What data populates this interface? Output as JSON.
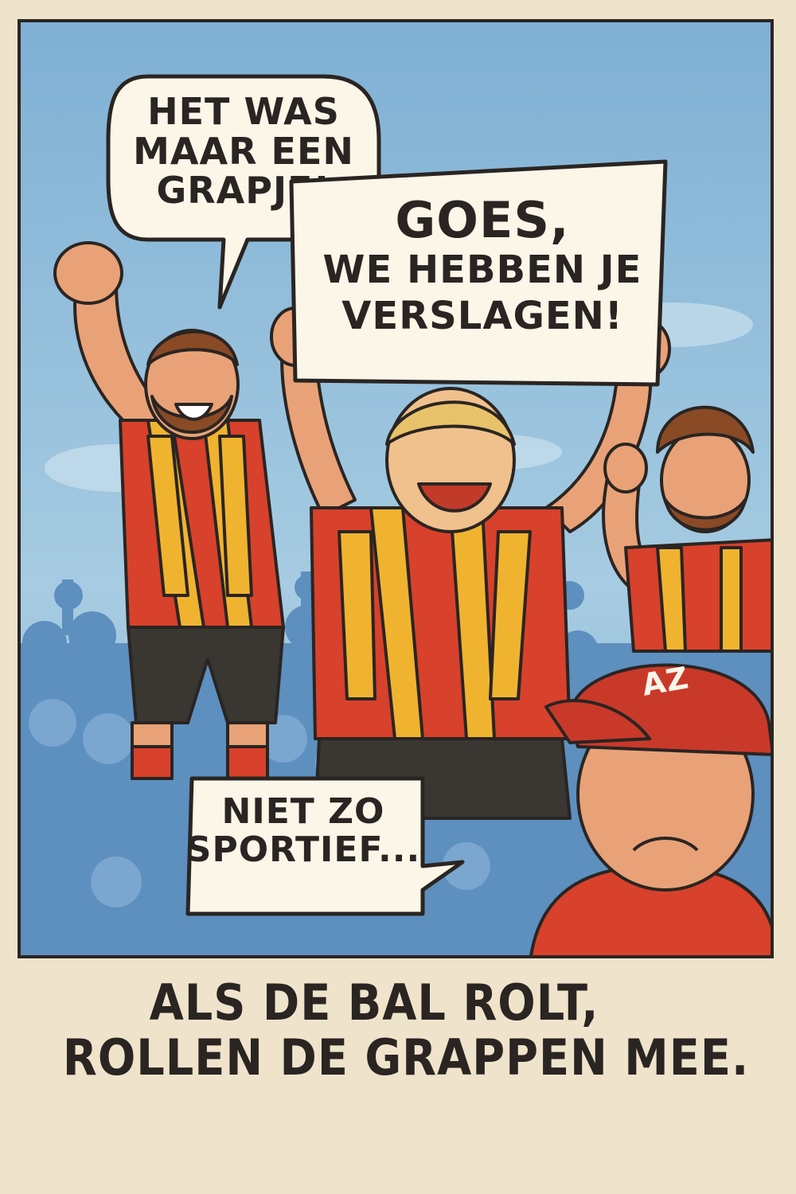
{
  "bubble_left": {
    "lines": [
      "HET WAS",
      "MAAR EEN",
      "GRAPJE!"
    ]
  },
  "banner": {
    "lines": [
      "GOES,",
      "WE HEBBEN JE",
      "VERSLAGEN!"
    ]
  },
  "bubble_bottom": {
    "lines": [
      "NIET ZO",
      "SPORTIEF..."
    ]
  },
  "cap_text": "AZ",
  "caption": {
    "lines": [
      "ALS DE BAL ROLT,",
      "ROLLEN DE GRAPPEN MEE."
    ]
  },
  "colors": {
    "sky": "#8fbbd8",
    "jersey_red": "#d8412b",
    "scarf_yellow": "#f0b330",
    "outline": "#2a2522",
    "paper": "#efe3cc"
  }
}
